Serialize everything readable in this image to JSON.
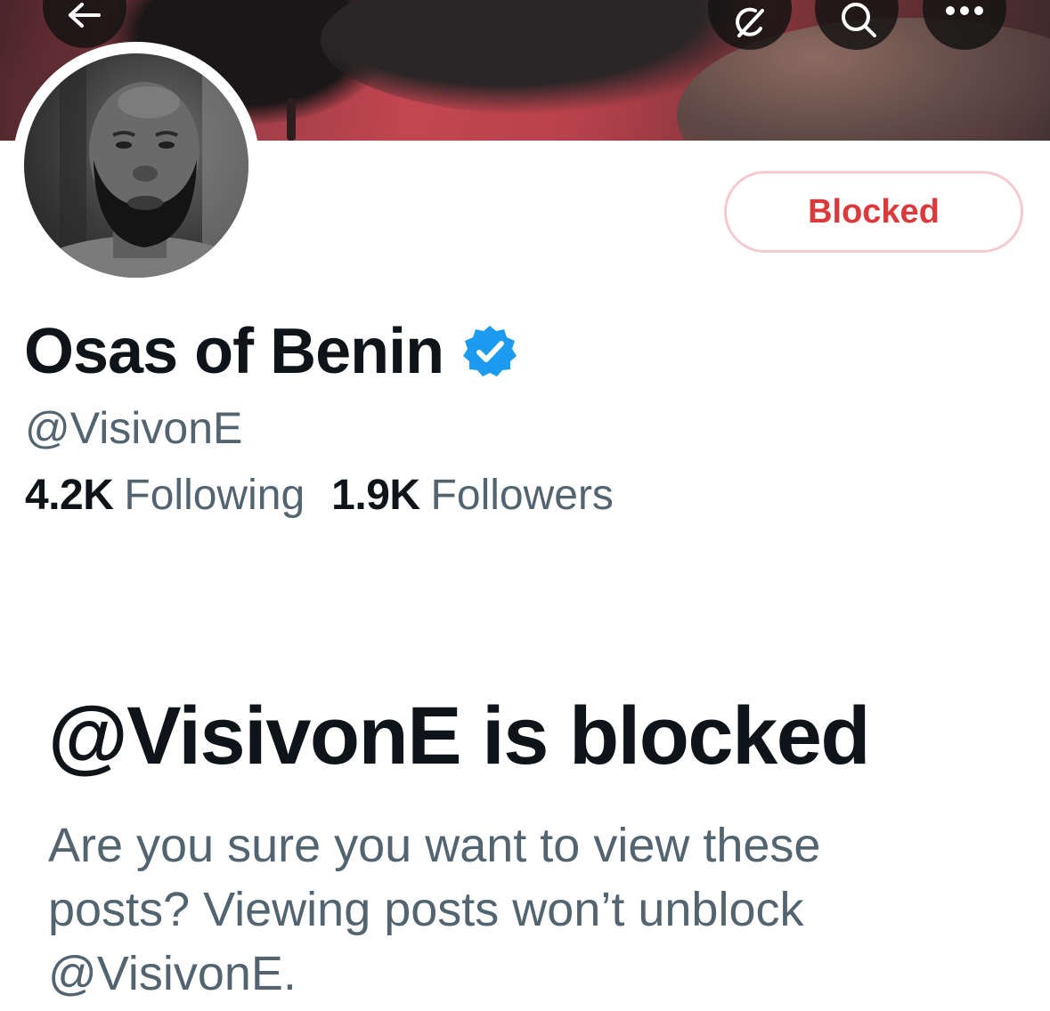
{
  "header": {
    "back_icon": "arrow-left-icon",
    "grok_icon": "grok-icon",
    "search_icon": "search-icon",
    "more_icon": "more-horizontal-icon"
  },
  "profile": {
    "display_name": "Osas of Benin",
    "verified": true,
    "verified_color": "#1d9bf0",
    "handle": "@VisivonE",
    "following_count": "4.2K",
    "following_label": "Following",
    "followers_count": "1.9K",
    "followers_label": "Followers"
  },
  "actions": {
    "blocked_label": "Blocked",
    "blocked_color": "#dc3a3a"
  },
  "blocked_notice": {
    "title": "@VisivonE is blocked",
    "description": "Are you sure you want to view these posts? Viewing posts won’t unblock @VisivonE."
  }
}
